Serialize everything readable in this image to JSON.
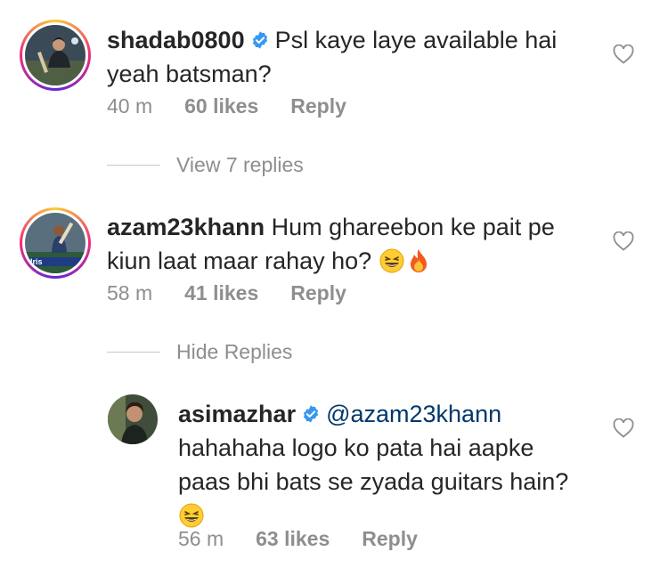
{
  "comments": [
    {
      "username": "shadab0800",
      "verified": true,
      "text_line1": "Psl kaye laye available hai",
      "text_line2": "yeah batsman?",
      "time": "40 m",
      "likes": "60 likes",
      "reply": "Reply",
      "avatar": "avatar-cricketer-photo"
    },
    {
      "username": "azam23khann",
      "verified": false,
      "text_line1": "Hum ghareebon ke pait pe",
      "text_line2": "kiun laat maar rahay ho?",
      "time": "58 m",
      "likes": "41 likes",
      "reply": "Reply",
      "avatar": "avatar-batsman-photo"
    }
  ],
  "view_replies": "View 7 replies",
  "hide_replies": "Hide Replies",
  "reply_comment": {
    "username": "asimazhar",
    "verified": true,
    "mention": "@azam23khann",
    "text_line1": "hahahaha logo ko pata hai aapke",
    "text_line2": "paas bhi bats se zyada guitars hain?",
    "time": "56 m",
    "likes": "63 likes",
    "reply": "Reply",
    "avatar": "avatar-portrait-photo"
  },
  "colors": {
    "text": "#262626",
    "secondary": "#8e8e8e",
    "mention": "#00376b",
    "verified": "#3897f0",
    "story_ring_start": "#f9ce34",
    "story_ring_mid": "#ee2a7b",
    "story_ring_end": "#6228d7"
  },
  "icons": [
    "verified-badge-icon",
    "heart-outline-icon",
    "laughing-emoji-icon",
    "fire-emoji-icon"
  ]
}
